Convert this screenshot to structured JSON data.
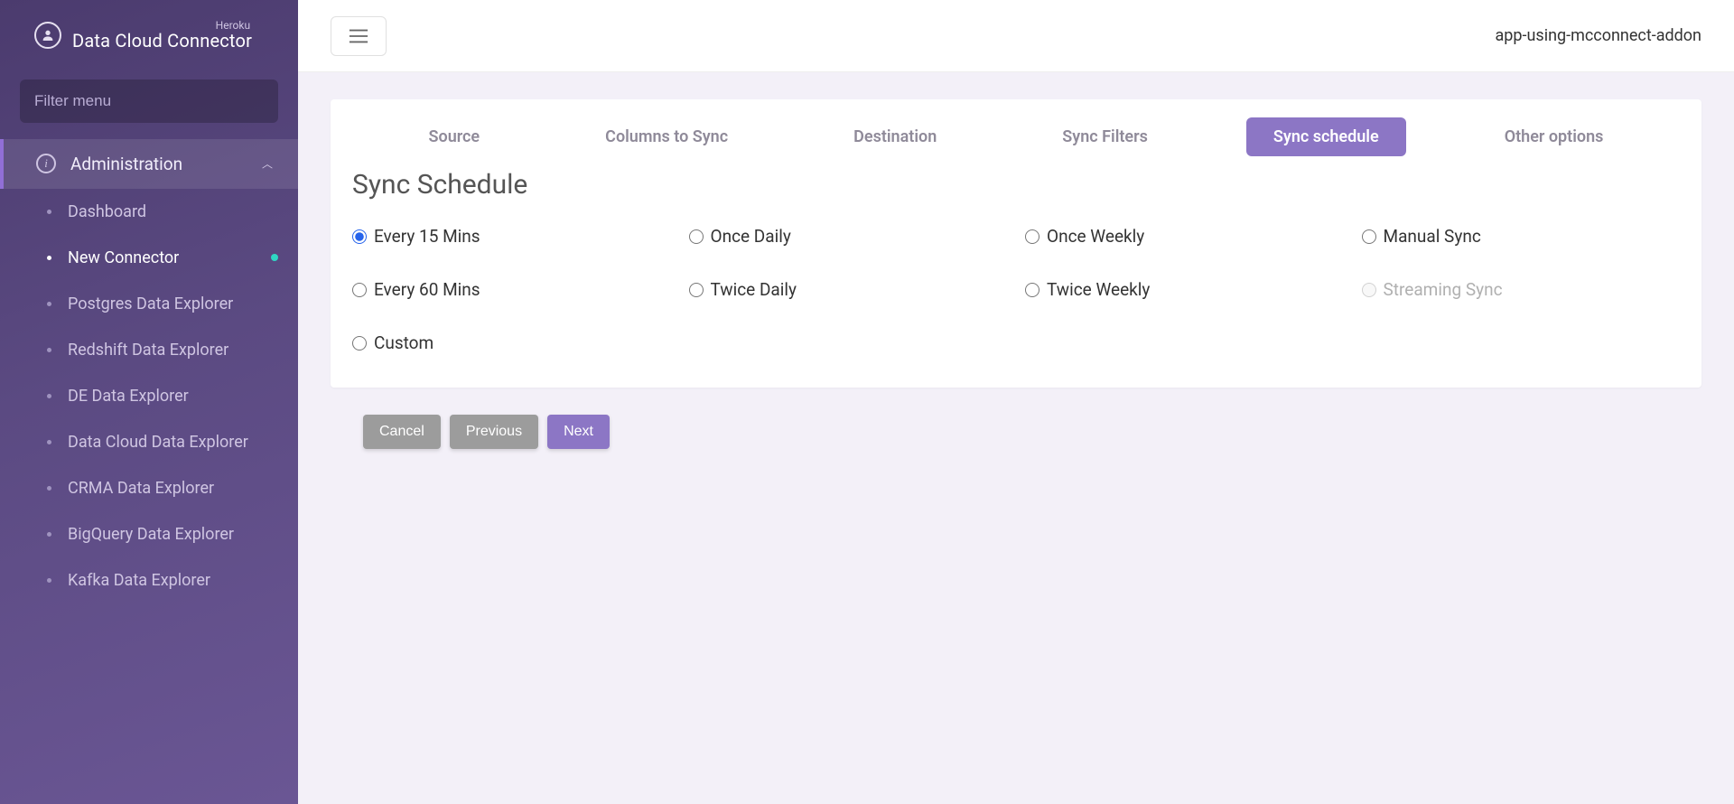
{
  "brand": {
    "super": "Heroku",
    "title": "Data Cloud Connector"
  },
  "sidebar": {
    "filter_placeholder": "Filter menu",
    "group_label": "Administration",
    "items": [
      {
        "label": "Dashboard",
        "active": false
      },
      {
        "label": "New Connector",
        "active": true,
        "status": true
      },
      {
        "label": "Postgres Data Explorer",
        "active": false
      },
      {
        "label": "Redshift Data Explorer",
        "active": false
      },
      {
        "label": "DE Data Explorer",
        "active": false
      },
      {
        "label": "Data Cloud Data Explorer",
        "active": false
      },
      {
        "label": "CRMA Data Explorer",
        "active": false
      },
      {
        "label": "BigQuery Data Explorer",
        "active": false
      },
      {
        "label": "Kafka Data Explorer",
        "active": false
      }
    ]
  },
  "header": {
    "app_name": "app-using-mcconnect-addon"
  },
  "tabs": [
    {
      "label": "Source",
      "active": false
    },
    {
      "label": "Columns to Sync",
      "active": false
    },
    {
      "label": "Destination",
      "active": false
    },
    {
      "label": "Sync Filters",
      "active": false
    },
    {
      "label": "Sync schedule",
      "active": true
    },
    {
      "label": "Other options",
      "active": false
    }
  ],
  "section": {
    "title": "Sync Schedule"
  },
  "schedule_options": [
    {
      "label": "Every 15 Mins",
      "checked": true,
      "disabled": false,
      "col": 1
    },
    {
      "label": "Once Daily",
      "checked": false,
      "disabled": false,
      "col": 2
    },
    {
      "label": "Once Weekly",
      "checked": false,
      "disabled": false,
      "col": 3
    },
    {
      "label": "Manual Sync",
      "checked": false,
      "disabled": false,
      "col": 4
    },
    {
      "label": "Every 60 Mins",
      "checked": false,
      "disabled": false,
      "col": 1
    },
    {
      "label": "Twice Daily",
      "checked": false,
      "disabled": false,
      "col": 2
    },
    {
      "label": "Twice Weekly",
      "checked": false,
      "disabled": false,
      "col": 3
    },
    {
      "label": "Streaming Sync",
      "checked": false,
      "disabled": true,
      "col": 4
    },
    {
      "label": "Custom",
      "checked": false,
      "disabled": false,
      "col": 1
    }
  ],
  "actions": {
    "cancel": "Cancel",
    "previous": "Previous",
    "next": "Next"
  }
}
